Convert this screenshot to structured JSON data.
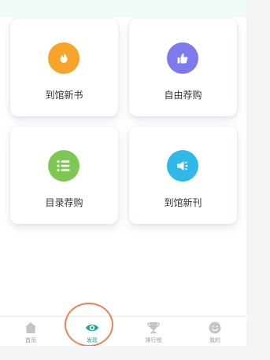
{
  "cards": [
    {
      "label": "到馆新书",
      "icon": "fire-icon",
      "color": "#f7a42a"
    },
    {
      "label": "自由荐购",
      "icon": "thumbs-up-icon",
      "color": "#7f79ee"
    },
    {
      "label": "目录荐购",
      "icon": "list-icon",
      "color": "#7dc752"
    },
    {
      "label": "到馆新刊",
      "icon": "megaphone-icon",
      "color": "#2fb8e8"
    }
  ],
  "tabbar": {
    "items": [
      {
        "label": "首页",
        "icon": "home-icon",
        "active": false
      },
      {
        "label": "发现",
        "icon": "eye-icon",
        "active": true
      },
      {
        "label": "排行榜",
        "icon": "trophy-icon",
        "active": false
      },
      {
        "label": "我的",
        "icon": "smile-icon",
        "active": false
      }
    ],
    "active_color": "#1aa79a",
    "inactive_color": "#c4c4c4"
  },
  "highlight_color": "#ee8352"
}
